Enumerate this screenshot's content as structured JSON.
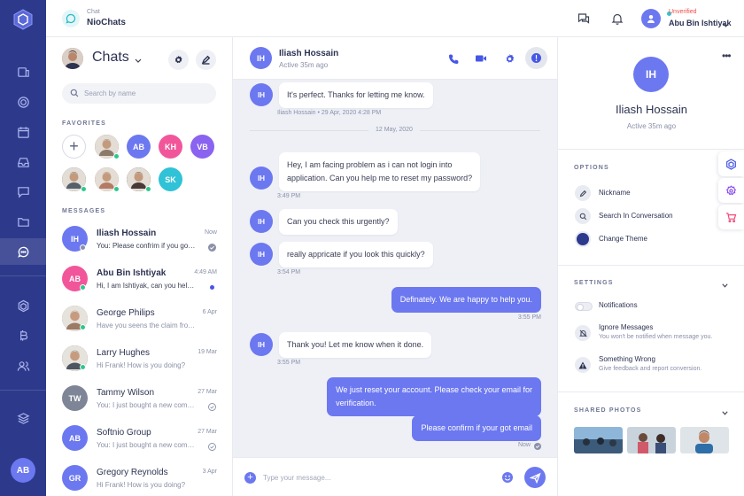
{
  "app": {
    "section": "Chat",
    "title": "NioChats"
  },
  "user": {
    "status": "Unverified",
    "name": "Abu Bin Ishtiyak",
    "initials": "AB"
  },
  "chat_list": {
    "title": "Chats",
    "search_placeholder": "Search by name",
    "favorites_heading": "FAVORITES",
    "favorites": [
      {
        "kind": "add",
        "label": "+"
      },
      {
        "kind": "photo",
        "initials": "",
        "color": "#8c7a6b",
        "online": true
      },
      {
        "kind": "initials",
        "initials": "AB",
        "color": "#6c78f0",
        "online": true
      },
      {
        "kind": "initials",
        "initials": "KH",
        "color": "#f2569a",
        "online": true
      },
      {
        "kind": "initials",
        "initials": "VB",
        "color": "#8a63f0",
        "online": true
      },
      {
        "kind": "photo",
        "initials": "",
        "color": "#55606b",
        "online": true
      },
      {
        "kind": "photo",
        "initials": "",
        "color": "#b57a63",
        "online": true
      },
      {
        "kind": "photo",
        "initials": "",
        "color": "#4a3a37",
        "online": true
      },
      {
        "kind": "initials",
        "initials": "SK",
        "color": "#30c2d6",
        "online": true
      }
    ],
    "messages_heading": "MESSAGES",
    "items": [
      {
        "name": "Iliash Hossain",
        "initials": "IH",
        "color": "#6c78f0",
        "preview": "You: Please confrim if you got my last messages.",
        "time": "Now",
        "status": "check",
        "bold": true,
        "active": true
      },
      {
        "name": "Abu Bin Ishtiyak",
        "initials": "AB",
        "color": "#f2569a",
        "preview": "Hi, I am Ishtiyak, can you help me with this problem?",
        "time": "4:49 AM",
        "status": "unread",
        "bold": true,
        "active": false
      },
      {
        "name": "George Philips",
        "initials": "",
        "color": "#9c7a63",
        "preview": "Have you seens the claim from Rose?",
        "time": "6 Apr",
        "status": "",
        "bold": false,
        "active": false
      },
      {
        "name": "Larry Hughes",
        "initials": "",
        "color": "#4c5560",
        "preview": "Hi Frank! How is you doing?",
        "time": "19 Mar",
        "status": "",
        "bold": false,
        "active": false
      },
      {
        "name": "Tammy Wilson",
        "initials": "TW",
        "color": "#7d8596",
        "preview": "You: I just bought a new computer but i am having some problem",
        "time": "27 Mar",
        "status": "check-outline",
        "bold": false,
        "active": false
      },
      {
        "name": "Softnio Group",
        "initials": "AB",
        "color": "#6c78f0",
        "preview": "You: I just bought a new computer but i am having some problem",
        "time": "27 Mar",
        "status": "check-outline",
        "bold": false,
        "active": false
      },
      {
        "name": "Gregory Reynolds",
        "initials": "GR",
        "color": "#6c78f0",
        "preview": "Hi Frank! How is you doing?",
        "time": "3 Apr",
        "status": "",
        "bold": false,
        "active": false
      }
    ]
  },
  "conversation": {
    "name": "Iliash Hossain",
    "initials": "IH",
    "status": "Active 35m ago",
    "date_separator": "12 May, 2020",
    "messages": [
      {
        "dir": "in",
        "lines": [
          "It's perfect. Thanks for letting me know."
        ],
        "meta": "Iliash Hossain  •  29 Apr, 2020 4:28 PM"
      },
      {
        "dir": "in",
        "lines": [
          "Hey, I am facing problem as i can not login into",
          "application. Can you help me to reset my password?"
        ],
        "meta": "3:49 PM"
      },
      {
        "dir": "in",
        "lines": [
          "Can you check this urgently?"
        ],
        "meta": ""
      },
      {
        "dir": "in",
        "lines": [
          "really appricate if you look this quickly?"
        ],
        "meta": "3:54 PM"
      },
      {
        "dir": "out",
        "lines": [
          "Definately. We are happy to help you."
        ],
        "meta": "3:55 PM"
      },
      {
        "dir": "in",
        "lines": [
          "Thank you! Let me know when it done."
        ],
        "meta": "3:55 PM"
      },
      {
        "dir": "out",
        "lines": [
          "We just reset your account. Please check your email for",
          "verification."
        ],
        "meta": ""
      },
      {
        "dir": "out",
        "lines": [
          "Please confirm if your got email"
        ],
        "meta": "Now"
      }
    ],
    "input_placeholder": "Type your message..."
  },
  "profile": {
    "initials": "IH",
    "name": "Iliash Hossain",
    "status": "Active 35m ago",
    "options_heading": "OPTIONS",
    "options": [
      {
        "label": "Nickname",
        "icon": "pencil-icon"
      },
      {
        "label": "Search In Conversation",
        "icon": "search-icon"
      },
      {
        "label": "Change Theme",
        "icon": "theme-icon"
      }
    ],
    "settings_heading": "SETTINGS",
    "settings": [
      {
        "label": "Notifications",
        "desc": "",
        "icon": "toggle"
      },
      {
        "label": "Ignore Messages",
        "desc": "You won't be notified when message you.",
        "icon": "bell-off-icon"
      },
      {
        "label": "Something Wrong",
        "desc": "Give feedback and report conversion.",
        "icon": "alert-icon"
      }
    ],
    "photos_heading": "SHARED PHOTOS"
  },
  "colors": {
    "rail": "#2d3a8c",
    "accent": "#6c78f0",
    "online": "#2cc88a",
    "unverified": "#f04b4b"
  }
}
